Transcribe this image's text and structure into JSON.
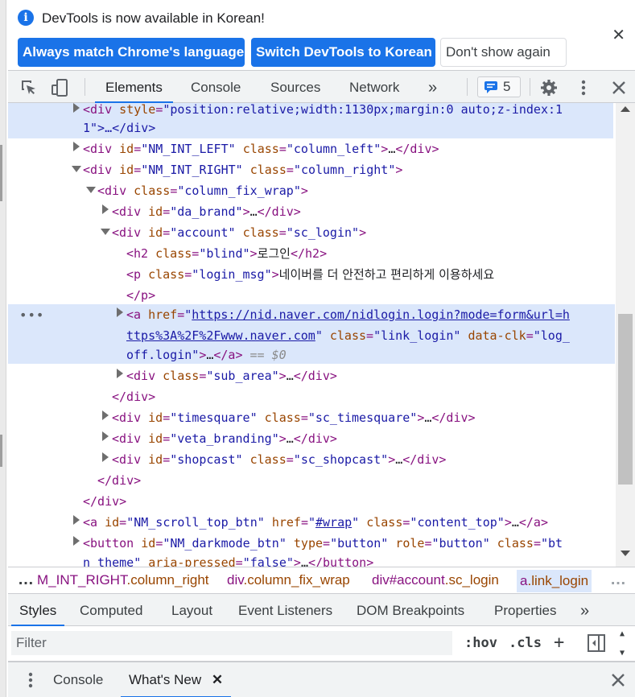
{
  "infobar": {
    "message": "DevTools is now available in Korean!",
    "buttons": {
      "match": "Always match Chrome's language",
      "switch": "Switch DevTools to Korean",
      "dismiss": "Don't show again"
    }
  },
  "toolbar": {
    "tabs": [
      "Elements",
      "Console",
      "Sources",
      "Network"
    ],
    "issues_count": "5"
  },
  "tree": {
    "l1_style": "position:relative;width:1130px;margin:0 auto;z-index:1",
    "l1_cont": "1\">…</div>",
    "l2_id": "NM_INT_LEFT",
    "l2_class": "column_left",
    "l3_id": "NM_INT_RIGHT",
    "l3_class": "column_right",
    "l4_class": "column_fix_wrap",
    "l5_id": "da_brand",
    "l6_id": "account",
    "l6_class": "sc_login",
    "l7_class": "blind",
    "l7_text": "로그인",
    "l8_class": "login_msg",
    "l8_text": "네이버를 더 안전하고 편리하게 이용하세요",
    "l10_href_a": "https://nid.naver.com/nidlogin.login?mode=form&url=h",
    "l10_href_b": "ttps%3A%2F%2Fwww.naver.com",
    "l10_class": "link_login",
    "l10_clk_a": "log_",
    "l10_clk_b": "off.login",
    "l10_eq": "== $0",
    "l11_class": "sub_area",
    "l13_id": "timesquare",
    "l13_class": "sc_timesquare",
    "l14_id": "veta_branding",
    "l15_id": "shopcast",
    "l15_class": "sc_shopcast",
    "l18_id": "NM_scroll_top_btn",
    "l18_href": "#wrap",
    "l18_class": "content_top",
    "l19_id": "NM_darkmode_btn",
    "l19_type": "button",
    "l19_role": "button",
    "l19_class_a": "bt",
    "l19_class_b": "n_theme",
    "l19_pressed": "false"
  },
  "breadcrumb": [
    {
      "node": "M_INT_RIGHT",
      "cls": ".column_right"
    },
    {
      "node": "div",
      "cls": ".column_fix_wrap"
    },
    {
      "node": "div#account",
      "cls": ".sc_login"
    },
    {
      "node": "a",
      "cls": ".link_login"
    }
  ],
  "styles_tabs": [
    "Styles",
    "Computed",
    "Layout",
    "Event Listeners",
    "DOM Breakpoints",
    "Properties"
  ],
  "filter": {
    "placeholder": "Filter",
    "hov": ":hov",
    "cls": ".cls"
  },
  "drawer": {
    "tabs": [
      "Console",
      "What's New"
    ]
  }
}
